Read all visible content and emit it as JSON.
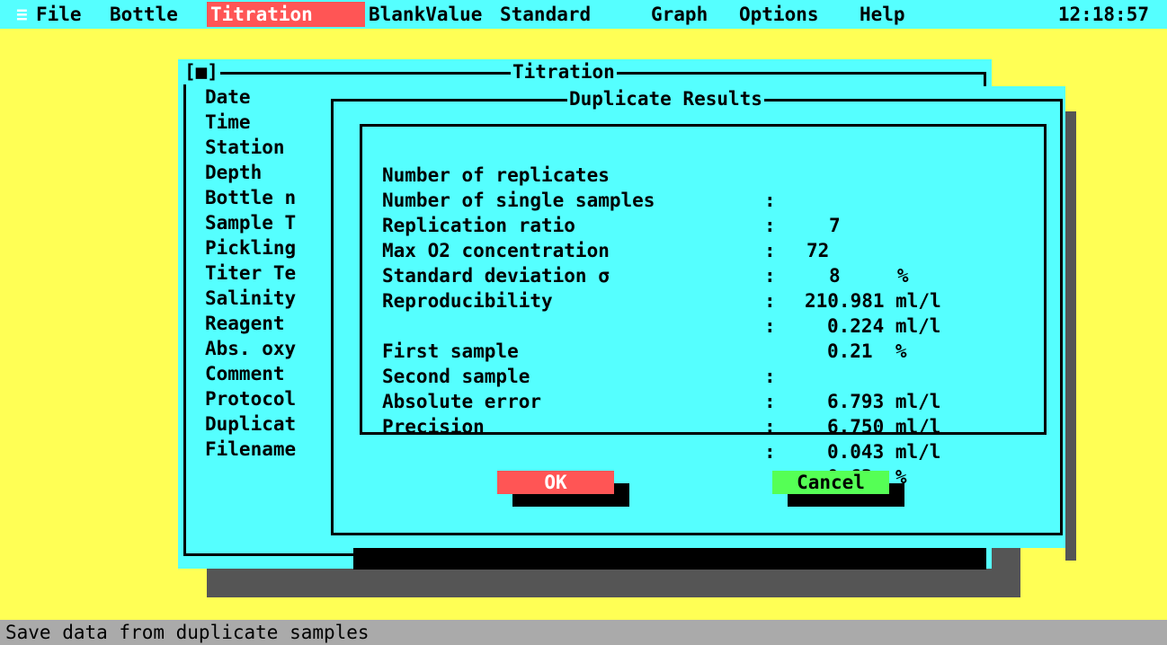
{
  "menubar": {
    "system_icon": "≡",
    "items": [
      {
        "label": "File"
      },
      {
        "label": "Bottle"
      },
      {
        "label": "Titration"
      },
      {
        "label": "BlankValue"
      },
      {
        "label": "Standard"
      },
      {
        "label": "Graph"
      },
      {
        "label": "Options"
      },
      {
        "label": "Help"
      }
    ],
    "active": "Titration",
    "clock": "12:18:57"
  },
  "titration_window": {
    "title": "Titration",
    "close_box": "[■]",
    "fields": [
      "Date",
      "Time",
      "Station",
      "Depth",
      "Bottle n",
      "Sample T",
      "Pickling",
      "Titer Te",
      "Salinity",
      "Reagent",
      "Abs. oxy",
      "Comment",
      "Protocol",
      "Duplicat",
      "Filename"
    ]
  },
  "dialog": {
    "title": "Duplicate Results",
    "rows": [
      {
        "label": "Number of replicates",
        "colon": ":",
        "value": "7"
      },
      {
        "label": "Number of single samples",
        "colon": ":",
        "value": "72"
      },
      {
        "label": "Replication ratio",
        "colon": ":",
        "value": "8     %"
      },
      {
        "label": "Max O2 concentration",
        "colon": ":",
        "value": "210.981 ml/l"
      },
      {
        "label": "Standard deviation σ",
        "colon": ":",
        "value": "0.224 ml/l"
      },
      {
        "label": "Reproducibility",
        "colon": ":",
        "value": "0.21  %"
      },
      {
        "label": "First sample",
        "colon": ":",
        "value": "6.793 ml/l"
      },
      {
        "label": "Second sample",
        "colon": ":",
        "value": "6.750 ml/l"
      },
      {
        "label": "Absolute error",
        "colon": ":",
        "value": "0.043 ml/l"
      },
      {
        "label": "Precision",
        "colon": ":",
        "value": "0.63  %"
      }
    ],
    "ok_label": "OK",
    "cancel_label": "Cancel"
  },
  "status": "Save data from duplicate samples",
  "colors": {
    "desktop": "#ffff55",
    "window": "#55ffff",
    "active_menu": "#ff5555",
    "ok_button": "#ff5555",
    "cancel_button": "#55ff55",
    "status_bar": "#aaaaaa"
  }
}
